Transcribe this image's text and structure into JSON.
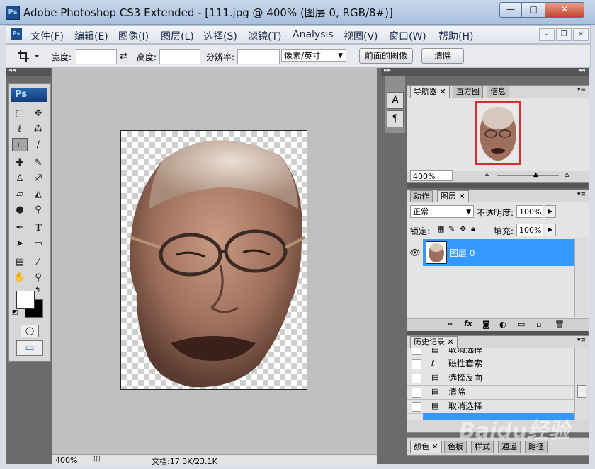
{
  "window": {
    "app_icon": "Ps",
    "title": "Adobe Photoshop CS3 Extended - [111.jpg @ 400% (图层 0, RGB/8#)]",
    "min_glyph": "—",
    "max_glyph": "□",
    "close_glyph": "✕"
  },
  "menu": {
    "ps_label": "Ps",
    "items": [
      "文件(F)",
      "编辑(E)",
      "图像(I)",
      "图层(L)",
      "选择(S)",
      "滤镜(T)",
      "Analysis",
      "视图(V)",
      "窗口(W)",
      "帮助(H)"
    ],
    "doc_min": "–",
    "doc_restore": "❐",
    "doc_close": "✕"
  },
  "options": {
    "tool_icon": "crop-icon",
    "width_label": "宽度:",
    "width_value": "",
    "swap_glyph": "⇄",
    "height_label": "高度:",
    "height_value": "",
    "resolution_label": "分辨率:",
    "resolution_value": "",
    "unit_value": "像素/英寸",
    "front_image_label": "前面的图像",
    "clear_label": "清除"
  },
  "toolbox": {
    "ps_label": "Ps",
    "quickmask_glyph": "◯",
    "screenmode_glyph": "▭"
  },
  "status": {
    "zoom": "400%",
    "doc_info": "文档:17.3K/23.1K"
  },
  "navigator": {
    "tabs": [
      "导航器",
      "直方图",
      "信息"
    ],
    "zoom": "400%"
  },
  "layers": {
    "tabs": [
      "动作",
      "图层"
    ],
    "blend_mode": "正常",
    "opacity_label": "不透明度:",
    "opacity_value": "100%",
    "lock_label": "锁定:",
    "fill_label": "填充:",
    "fill_value": "100%",
    "layer_name": "图层 0",
    "footer_icons": [
      "link-icon",
      "fx-icon",
      "mask-icon",
      "adjustment-icon",
      "group-icon",
      "new-layer-icon",
      "trash-icon"
    ]
  },
  "history": {
    "tab": "历史记录",
    "items": [
      "取消选择",
      "磁性套索",
      "选择反向",
      "清除",
      "取消选择"
    ]
  },
  "bottom_panel": {
    "tabs": [
      "颜色",
      "色板",
      "样式",
      "通道",
      "路径"
    ]
  },
  "watermark": "Baidu经验",
  "colors": {
    "selection_blue": "#3399ff",
    "workspace_gray": "#6b6b6b",
    "canvas_gray": "#c0c0c0",
    "close_red": "#c5452c"
  }
}
